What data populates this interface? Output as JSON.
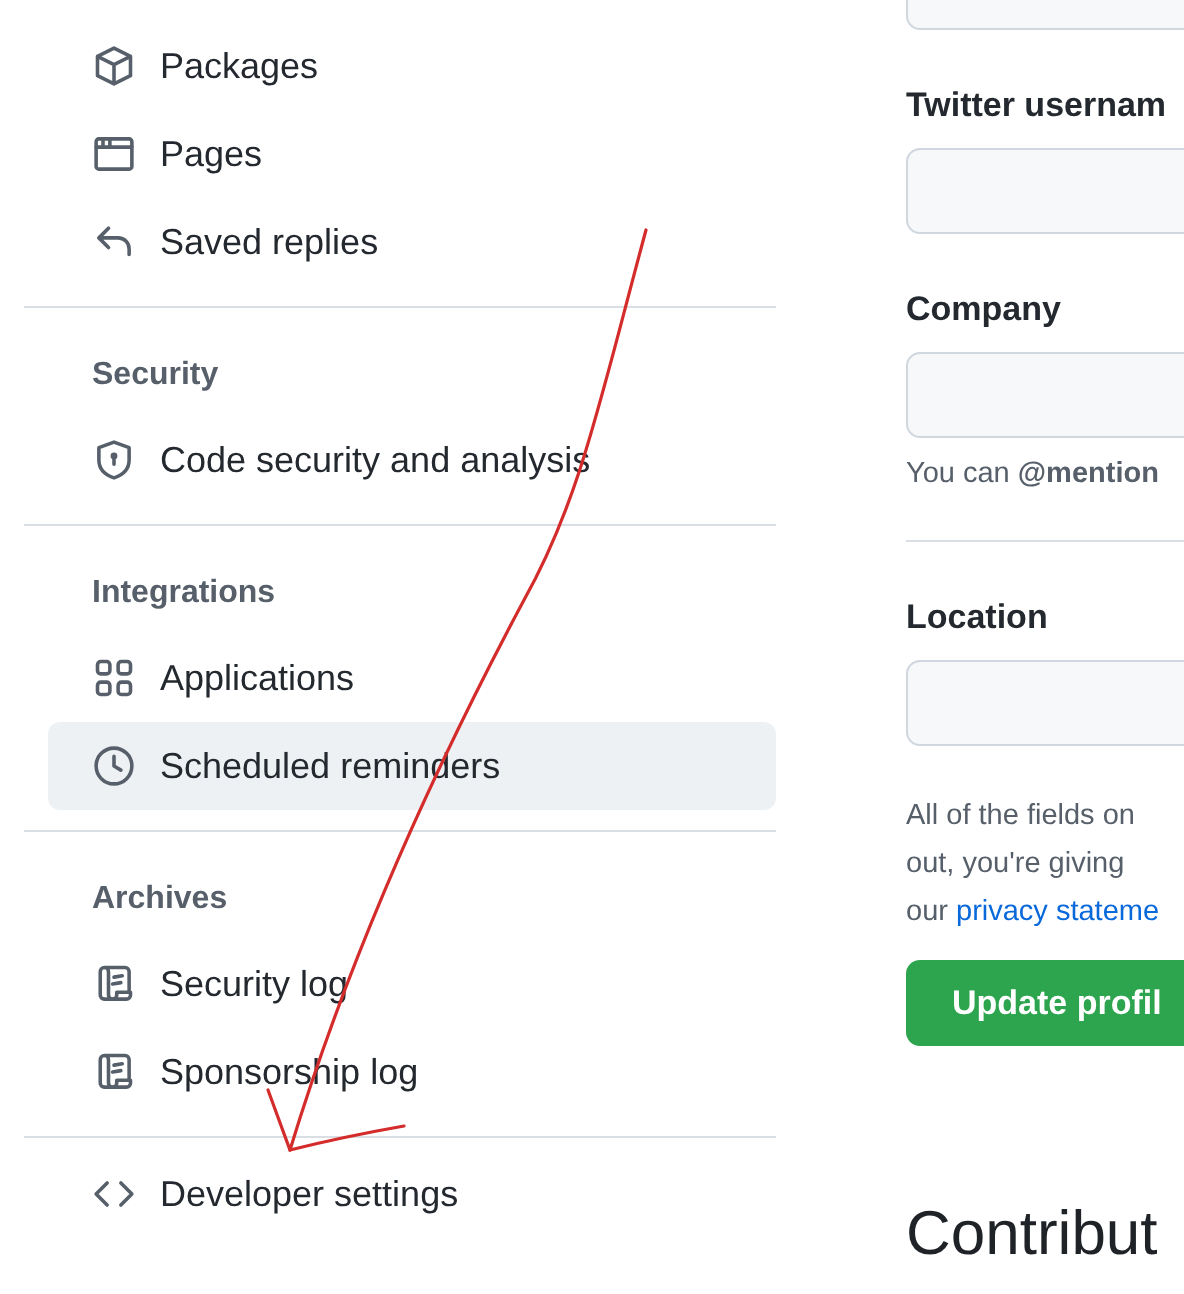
{
  "sidebar": {
    "sections": [
      {
        "items": [
          {
            "label": "Packages",
            "selected": false
          },
          {
            "label": "Pages",
            "selected": false
          },
          {
            "label": "Saved replies",
            "selected": false
          }
        ]
      },
      {
        "heading": "Security",
        "items": [
          {
            "label": "Code security and analysis",
            "selected": false
          }
        ]
      },
      {
        "heading": "Integrations",
        "items": [
          {
            "label": "Applications",
            "selected": false
          },
          {
            "label": "Scheduled reminders",
            "selected": true
          }
        ]
      },
      {
        "heading": "Archives",
        "items": [
          {
            "label": "Security log",
            "selected": false
          },
          {
            "label": "Sponsorship log",
            "selected": false
          }
        ]
      },
      {
        "items": [
          {
            "label": "Developer settings",
            "selected": false
          }
        ]
      }
    ]
  },
  "form": {
    "fields": [
      {
        "kind": "input"
      },
      {
        "kind": "input",
        "label": "Twitter usernam"
      },
      {
        "kind": "input",
        "label": "Company",
        "note": "You can **@mention**"
      },
      {
        "kind": "divider"
      },
      {
        "kind": "input",
        "label": "Location"
      }
    ],
    "notice": [
      "All of the fields on",
      "out, you're giving"
    ],
    "notice_last": {
      "text": "our",
      "link": "privacy stateme"
    },
    "button": "Update profil",
    "next_heading": "Contribut"
  }
}
